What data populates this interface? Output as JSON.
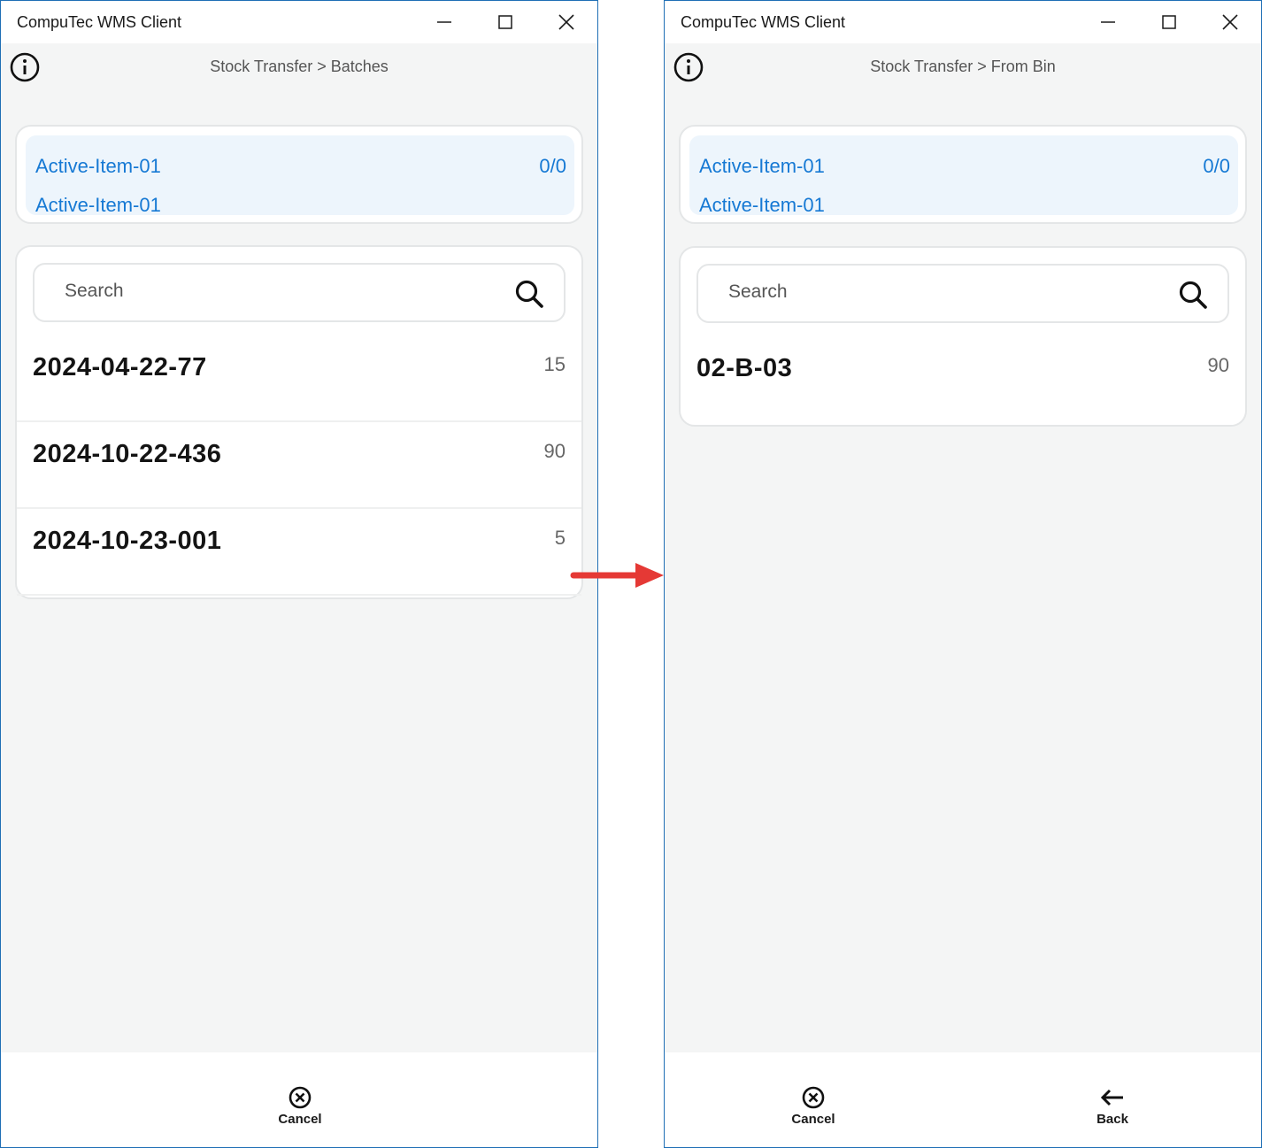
{
  "left_window": {
    "title": "CompuTec WMS Client",
    "breadcrumb": "Stock Transfer > Batches",
    "item": {
      "name": "Active-Item-01",
      "code": "Active-Item-01",
      "count": "0/0"
    },
    "search": {
      "placeholder": "Search"
    },
    "rows": [
      {
        "label": "2024-04-22-77",
        "qty": "15"
      },
      {
        "label": "2024-10-22-436",
        "qty": "90"
      },
      {
        "label": "2024-10-23-001",
        "qty": "5"
      }
    ],
    "footer": {
      "cancel_label": "Cancel"
    }
  },
  "right_window": {
    "title": "CompuTec WMS Client",
    "breadcrumb": "Stock Transfer > From Bin",
    "item": {
      "name": "Active-Item-01",
      "code": "Active-Item-01",
      "count": "0/0"
    },
    "search": {
      "placeholder": "Search"
    },
    "rows": [
      {
        "label": "02-B-03",
        "qty": "90"
      }
    ],
    "footer": {
      "cancel_label": "Cancel",
      "back_label": "Back"
    }
  },
  "icons": {
    "info": "info-circle-icon",
    "search": "search-icon",
    "cancel": "x-circle-icon",
    "back": "arrow-left-icon",
    "minimize": "minimize-icon",
    "maximize": "maximize-icon",
    "close": "close-icon",
    "flow": "red-right-arrow-icon"
  },
  "colors": {
    "accent_blue": "#1679d4",
    "item_highlight_bg": "#edf5fc",
    "window_border": "#1f6fb5",
    "content_bg": "#f4f5f5",
    "flow_arrow": "#e53935"
  }
}
